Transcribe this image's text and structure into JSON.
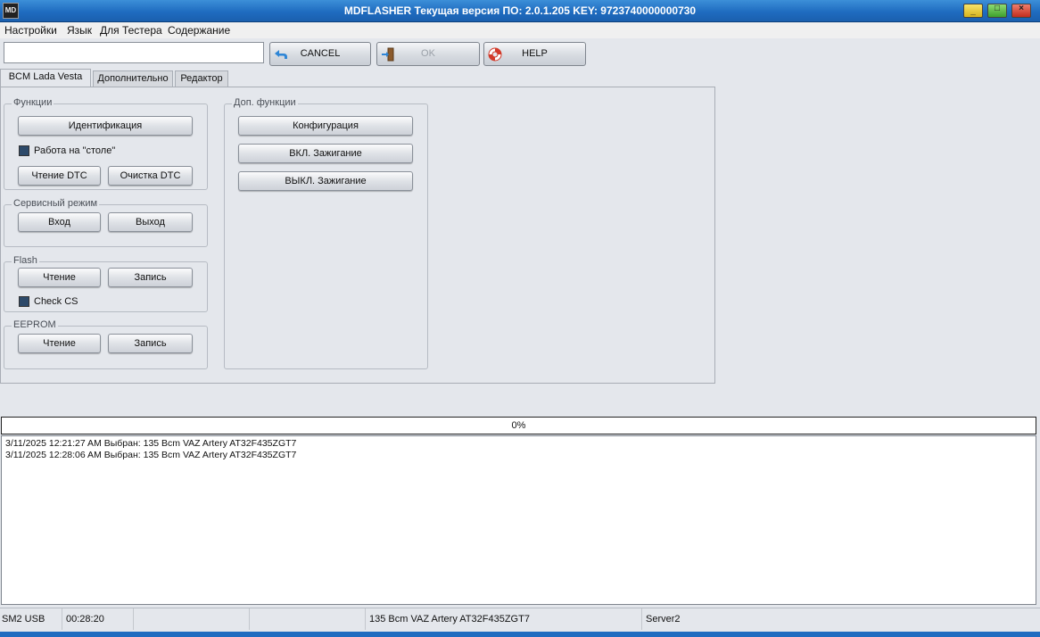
{
  "window": {
    "title": "MDFLASHER  Текущая версия ПО: 2.0.1.205  KEY: 9723740000000730",
    "icon_label": "MD"
  },
  "menu": [
    "Настройки",
    "Язык",
    "Для Тестера",
    "Содержание"
  ],
  "toolbar": {
    "input_value": "",
    "cancel_label": "CANCEL",
    "ok_label": "OK",
    "help_label": "HELP"
  },
  "tabs": [
    "BCM Lada Vesta NG",
    "Дополнительно",
    "Редактор"
  ],
  "groups": {
    "functions": {
      "title": "Функции",
      "identify_label": "Идентификация",
      "desk_mode_label": "Работа на \"столе\"",
      "read_dtc_label": "Чтение DTC",
      "clear_dtc_label": "Очистка DTC"
    },
    "service": {
      "title": "Сервисный режим",
      "enter_label": "Вход",
      "exit_label": "Выход"
    },
    "flash": {
      "title": "Flash",
      "read_label": "Чтение",
      "write_label": "Запись",
      "check_cs_label": "Check CS"
    },
    "eeprom": {
      "title": "EEPROM",
      "read_label": "Чтение",
      "write_label": "Запись"
    },
    "extra": {
      "title": "Доп. функции",
      "config_label": "Конфигурация",
      "ign_on_label": "ВКЛ. Зажигание",
      "ign_off_label": "ВЫКЛ. Зажигание"
    }
  },
  "progress": {
    "text": "0%",
    "value": 0
  },
  "log": [
    "3/11/2025 12:21:27 AM  Выбран:   135 Bcm VAZ Artery AT32F435ZGT7",
    "3/11/2025 12:28:06 AM  Выбран:   135 Bcm VAZ Artery AT32F435ZGT7"
  ],
  "status": {
    "interface": "SM2 USB",
    "time": "00:28:20",
    "empty1": "",
    "empty2": "",
    "device": "135 Bcm VAZ Artery AT32F435ZGT7",
    "server": "Server2"
  },
  "colors": {
    "titlebar": "#1f6cc0",
    "checkbox_fill": "#2d4a6a",
    "panel_bg": "#e4e7ec"
  }
}
